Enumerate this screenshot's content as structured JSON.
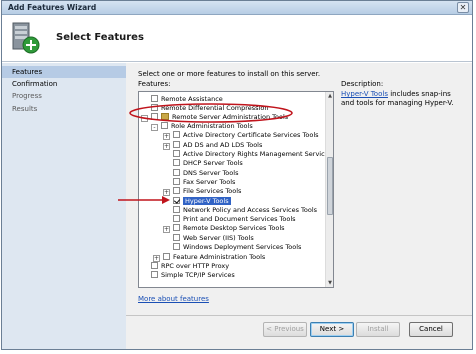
{
  "window": {
    "title": "Add Features Wizard",
    "close_glyph": "✕"
  },
  "header": {
    "heading": "Select Features",
    "icon": "add-features-wizard-icon"
  },
  "sidebar": {
    "items": [
      {
        "label": "Features",
        "state": "active"
      },
      {
        "label": "Confirmation",
        "state": "completed"
      },
      {
        "label": "Progress",
        "state": "pending"
      },
      {
        "label": "Results",
        "state": "pending"
      }
    ]
  },
  "content": {
    "instruction": "Select one or more features to install on this server.",
    "features_label": "Features:",
    "description_label": "Description:",
    "description_link": "Hyper-V Tools",
    "description_rest": " includes snap-ins and tools for managing Hyper-V.",
    "more_link": "More about features"
  },
  "tree": [
    {
      "label": "Remote Assistance",
      "checked": false,
      "expander": "",
      "folder": false
    },
    {
      "label": "Remote Differential Compression",
      "checked": false,
      "expander": "",
      "folder": false
    },
    {
      "label": "Remote Server Administration Tools",
      "checked": false,
      "expander": "-",
      "folder": true
    },
    {
      "label": "Role Administration Tools",
      "checked": false,
      "expander": "-",
      "folder": true
    },
    {
      "label": "Active Directory Certificate Services Tools",
      "checked": false,
      "expander": "+",
      "folder": false
    },
    {
      "label": "AD DS and AD LDS Tools",
      "checked": false,
      "expander": "+",
      "folder": false
    },
    {
      "label": "Active Directory Rights Management Services Tools",
      "checked": false,
      "expander": "",
      "folder": false
    },
    {
      "label": "DHCP Server Tools",
      "checked": false,
      "expander": "",
      "folder": false
    },
    {
      "label": "DNS Server Tools",
      "checked": false,
      "expander": "",
      "folder": false
    },
    {
      "label": "Fax Server Tools",
      "checked": false,
      "expander": "",
      "folder": false
    },
    {
      "label": "File Services Tools",
      "checked": false,
      "expander": "+",
      "folder": false
    },
    {
      "label": "Hyper-V Tools",
      "checked": true,
      "expander": "",
      "folder": false,
      "selected": true
    },
    {
      "label": "Network Policy and Access Services Tools",
      "checked": false,
      "expander": "",
      "folder": false
    },
    {
      "label": "Print and Document Services Tools",
      "checked": false,
      "expander": "",
      "folder": false
    },
    {
      "label": "Remote Desktop Services Tools",
      "checked": false,
      "expander": "+",
      "folder": false
    },
    {
      "label": "Web Server (IIS) Tools",
      "checked": false,
      "expander": "",
      "folder": false
    },
    {
      "label": "Windows Deployment Services Tools",
      "checked": false,
      "expander": "",
      "folder": false
    },
    {
      "label": "Feature Administration Tools",
      "checked": false,
      "expander": "+",
      "folder": false
    },
    {
      "label": "RPC over HTTP Proxy",
      "checked": false,
      "expander": "",
      "folder": false
    },
    {
      "label": "Simple TCP/IP Services",
      "checked": false,
      "expander": "",
      "folder": false
    }
  ],
  "buttons": {
    "previous": "< Previous",
    "next": "Next >",
    "install": "Install",
    "cancel": "Cancel"
  },
  "colors": {
    "annotation": "#c0141c",
    "selection": "#3163c5",
    "link": "#1a4fb5"
  }
}
